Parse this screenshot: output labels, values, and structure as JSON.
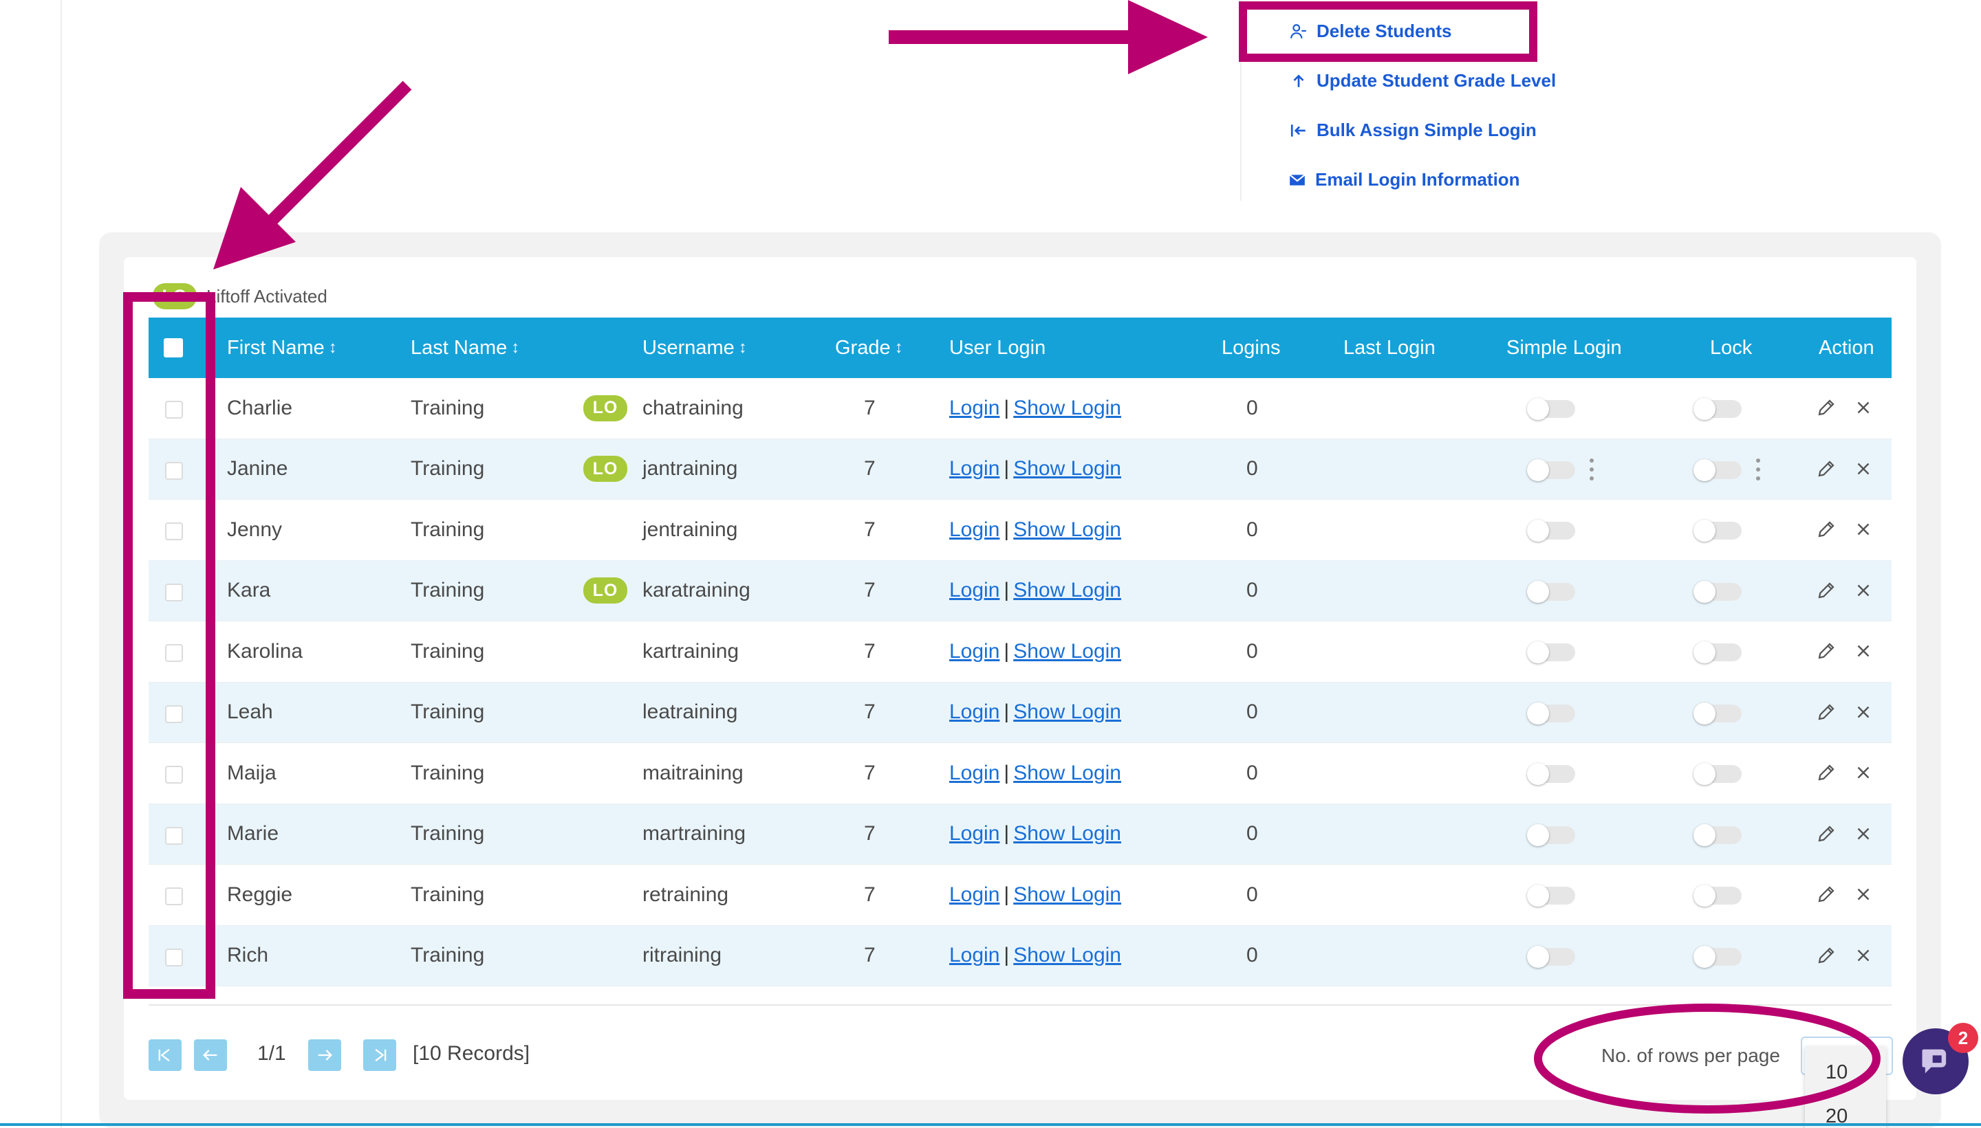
{
  "bulk_actions": {
    "delete_students": "Delete Students",
    "update_grade": "Update Student Grade Level",
    "bulk_simple_login": "Bulk Assign Simple Login",
    "email_login": "Email Login Information"
  },
  "legend": {
    "badge": "LO",
    "label": "Liftoff Activated"
  },
  "table": {
    "columns": {
      "first_name": "First Name",
      "last_name": "Last Name",
      "username": "Username",
      "grade": "Grade",
      "user_login": "User Login",
      "logins": "Logins",
      "last_login": "Last Login",
      "simple_login": "Simple Login",
      "lock": "Lock",
      "action": "Action"
    },
    "login_link": "Login",
    "separator": "|",
    "show_login_link": "Show Login",
    "rows": [
      {
        "first": "Charlie",
        "last": "Training",
        "lo": "LO",
        "username": "chatraining",
        "grade": "7",
        "logins": "0",
        "last_login": "",
        "simple_login": false,
        "lock": false
      },
      {
        "first": "Janine",
        "last": "Training",
        "lo": "LO",
        "username": "jantraining",
        "grade": "7",
        "logins": "0",
        "last_login": "",
        "simple_login": false,
        "lock": false
      },
      {
        "first": "Jenny",
        "last": "Training",
        "lo": "",
        "username": "jentraining",
        "grade": "7",
        "logins": "0",
        "last_login": "",
        "simple_login": false,
        "lock": false
      },
      {
        "first": "Kara",
        "last": "Training",
        "lo": "LO",
        "username": "karatraining",
        "grade": "7",
        "logins": "0",
        "last_login": "",
        "simple_login": false,
        "lock": false
      },
      {
        "first": "Karolina",
        "last": "Training",
        "lo": "",
        "username": "kartraining",
        "grade": "7",
        "logins": "0",
        "last_login": "",
        "simple_login": false,
        "lock": false
      },
      {
        "first": "Leah",
        "last": "Training",
        "lo": "",
        "username": "leatraining",
        "grade": "7",
        "logins": "0",
        "last_login": "",
        "simple_login": false,
        "lock": false
      },
      {
        "first": "Maija",
        "last": "Training",
        "lo": "",
        "username": "maitraining",
        "grade": "7",
        "logins": "0",
        "last_login": "",
        "simple_login": false,
        "lock": false
      },
      {
        "first": "Marie",
        "last": "Training",
        "lo": "",
        "username": "martraining",
        "grade": "7",
        "logins": "0",
        "last_login": "",
        "simple_login": false,
        "lock": false
      },
      {
        "first": "Reggie",
        "last": "Training",
        "lo": "",
        "username": "retraining",
        "grade": "7",
        "logins": "0",
        "last_login": "",
        "simple_login": false,
        "lock": false
      },
      {
        "first": "Rich",
        "last": "Training",
        "lo": "",
        "username": "ritraining",
        "grade": "7",
        "logins": "0",
        "last_login": "",
        "simple_login": false,
        "lock": false
      }
    ]
  },
  "pagination": {
    "page": "1/1",
    "records": "[10 Records]",
    "rows_per_page_label": "No. of rows per page",
    "options": [
      "10",
      "20"
    ]
  },
  "chat": {
    "badge": "2"
  },
  "colors": {
    "header": "#15a2d8",
    "annotation": "#b8006e",
    "link": "#1a5bd6",
    "lo_badge": "#a8c93a"
  }
}
